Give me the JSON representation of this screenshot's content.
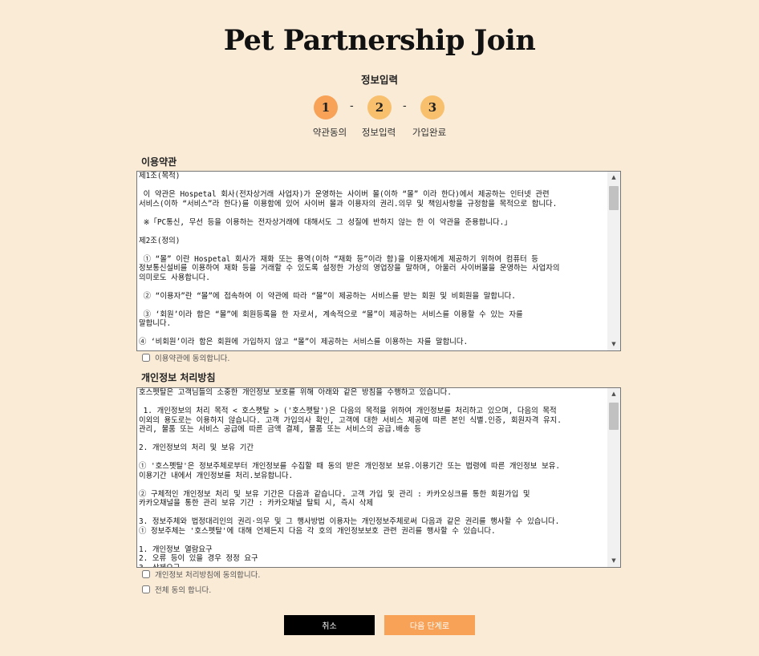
{
  "page": {
    "title": "Pet Partnership Join",
    "subtitle": "정보입력"
  },
  "steps": [
    {
      "number": "1",
      "label": "약관동의",
      "active": true
    },
    {
      "number": "2",
      "label": "정보입력",
      "active": false
    },
    {
      "number": "3",
      "label": "가입완료",
      "active": false
    }
  ],
  "step_separator": "-",
  "terms": {
    "heading": "이용약관",
    "content": "제1조(목적)\n\n 이 약관은 Hospetal 회사(전자상거래 사업자)가 운영하는 사이버 몰(이하 “몰” 이라 한다)에서 제공하는 인터넷 관련\n서비스(이하 “서비스”라 한다)를 이용함에 있어 사이버 몰과 이용자의 권리.의무 및 책임사항을 규정함을 목적으로 합니다.\n\n ※「PC통신, 무선 등을 이용하는 전자상거래에 대해서도 그 성질에 반하지 않는 한 이 약관을 준용합니다.」\n\n제2조(정의)\n\n ① “몰” 이란 Hospetal 회사가 재화 또는 용역(이하 “재화 등”이라 함)을 이용자에게 제공하기 위하여 컴퓨터 등\n정보통신설비를 이용하여 재화 등을 거래할 수 있도록 설정한 가상의 영업장을 말하며, 아울러 사이버몰을 운영하는 사업자의\n의미로도 사용합니다.\n\n ② “이용자”란 “몰”에 접속하여 이 약관에 따라 “몰”이 제공하는 서비스를 받는 회원 및 비회원을 말합니다.\n\n ③ ‘회원’이라 함은 “몰”에 회원등록을 한 자로서, 계속적으로 “몰”이 제공하는 서비스를 이용할 수 있는 자를\n말합니다.\n\n④ ‘비회원’이라 함은 회원에 가입하지 않고 “몰”이 제공하는 서비스를 이용하는 자를 말합니다.",
    "agree_label": "이용약관에 동의합니다."
  },
  "privacy": {
    "heading": "개인정보 처리방침",
    "content": "호스펫탈은 고객님들의 소중한 개인정보 보호를 위해 아래와 같은 방침을 수행하고 있습니다.\n\n 1. 개인정보의 처리 목적 < 호스펫탈 > ('호스펫탈')은 다음의 목적을 위하여 개인정보를 처리하고 있으며, 다음의 목적\n이외의 용도로는 이용하지 않습니다. 고객 가입의사 확인, 고객에 대한 서비스 제공에 따른 본인 식별.인증, 회원자격 유지.\n관리, 물품 또는 서비스 공급에 따른 금액 결제, 물품 또는 서비스의 공급.배송 등\n\n2. 개인정보의 처리 및 보유 기간\n\n① '호스펫탈'은 정보주체로부터 개인정보를 수집할 때 동의 받은 개인정보 보유.이용기간 또는 법령에 따른 개인정보 보유.\n이용기간 내에서 개인정보를 처리.보유합니다.\n\n② 구체적인 개인정보 처리 및 보유 기간은 다음과 같습니다. 고객 가입 및 관리 : 카카오싱크를 통한 회원가입 및\n카카오채널을 통한 관리 보유 기간 : 카카오채널 탈퇴 시, 즉시 삭제\n\n3. 정보주체와 법정대리인의 권리·의무 및 그 행사방법 이용자는 개인정보주체로써 다음과 같은 권리를 행사할 수 있습니다.\n① 정보주체는 '호스펫탈'에 대해 언제든지 다음 각 호의 개인정보보호 관련 권리를 행사할 수 있습니다.\n\n1. 개인정보 열람요구\n2. 오류 등이 있을 경우 정정 요구\n3. 삭제요구",
    "agree_label": "개인정보 처리방침에 동의합니다."
  },
  "agree_all_label": "전체 동의 합니다.",
  "buttons": {
    "cancel": "취소",
    "next": "다음 단계로"
  },
  "colors": {
    "background": "#faebd7",
    "active_step": "#f7a257",
    "inactive_step": "#f8bf6d",
    "cancel_button": "#000000",
    "next_button": "#f7a257"
  }
}
